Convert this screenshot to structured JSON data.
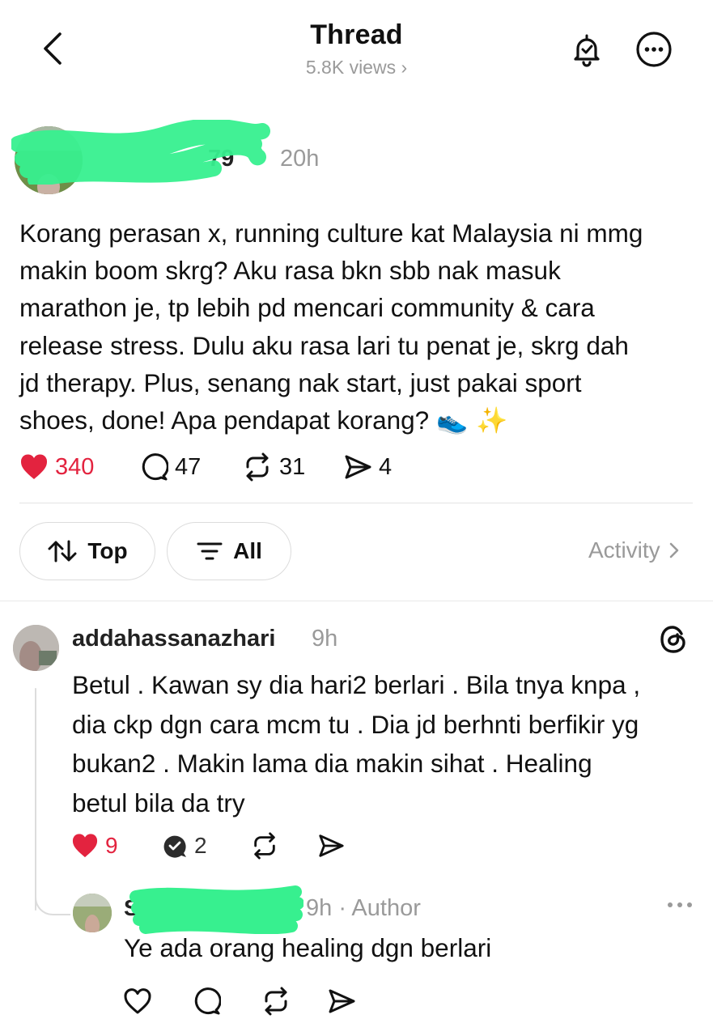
{
  "header": {
    "title": "Thread",
    "views": "5.8K views ›"
  },
  "post": {
    "username_tail": "79",
    "time": "20h",
    "text": "Korang perasan x, running culture kat Malaysia ni mmg\nmakin boom skrg? Aku rasa bkn sbb nak masuk\nmarathon je, tp lebih pd mencari community & cara\nrelease stress. Dulu aku rasa lari tu penat je, skrg dah\njd therapy. Plus, senang nak start, just pakai sport\nshoes, done! Apa pendapat korang?",
    "emojis": "👟 ✨",
    "likes": "340",
    "comments": "47",
    "reposts": "31",
    "shares": "4"
  },
  "filters": {
    "sort_label": "Top",
    "filter_label": "All",
    "activity_label": "Activity"
  },
  "reply": {
    "username": "addahassanazhari",
    "time": "9h",
    "text": "Betul . Kawan sy dia hari2 berlari . Bila tnya knpa ,\ndia ckp dgn cara mcm tu . Dia jd berhnti berfikir yg\nbukan2 . Makin lama dia makin sihat . Healing\nbetul bila da try",
    "likes": "9",
    "comments": "2"
  },
  "sub_reply": {
    "username_initial": "S",
    "meta": "9h · Author",
    "text": "Ye ada orang healing dgn berlari"
  },
  "colors": {
    "like_red": "#e3233f",
    "muted_gray": "#9a9a9a",
    "redaction_green": "#37f08f"
  }
}
